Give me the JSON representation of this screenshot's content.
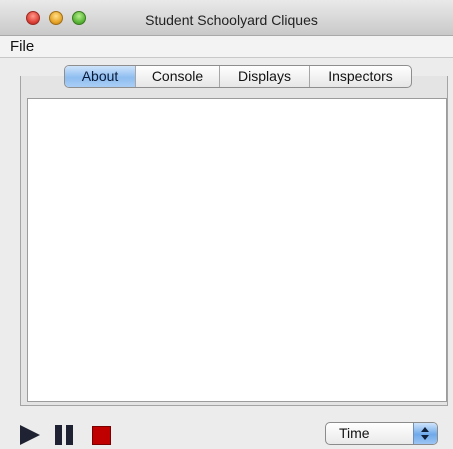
{
  "window": {
    "title": "Student Schoolyard Cliques"
  },
  "menu": {
    "file_label": "File"
  },
  "tabs": [
    {
      "label": "About",
      "active": true
    },
    {
      "label": "Console",
      "active": false
    },
    {
      "label": "Displays",
      "active": false
    },
    {
      "label": "Inspectors",
      "active": false
    }
  ],
  "controls": {
    "play_icon": "play-icon",
    "pause_icon": "pause-icon",
    "stop_icon": "stop-icon",
    "stop_color": "#c00000"
  },
  "time_select": {
    "selected": "Time"
  },
  "colors": {
    "active_tab": "#8ebdf0",
    "select_arrow": "#6ea9ea"
  }
}
